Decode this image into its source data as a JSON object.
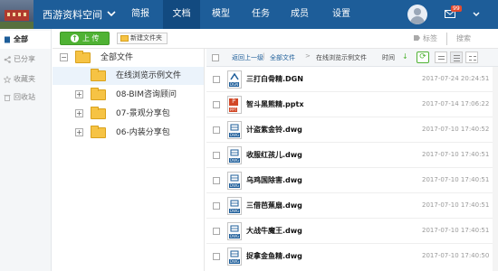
{
  "header": {
    "site_title": "西游资料空间",
    "nav": [
      "简报",
      "文档",
      "模型",
      "任务",
      "成员",
      "设置"
    ],
    "active_nav": "文档",
    "mail_badge": "99",
    "accent_color": "#1d5d99"
  },
  "sidebar": {
    "items": [
      {
        "label": "全部",
        "icon": "document-icon"
      },
      {
        "label": "已分享",
        "icon": "share-icon"
      },
      {
        "label": "收藏夹",
        "icon": "star-icon"
      },
      {
        "label": "回收站",
        "icon": "trash-icon"
      }
    ]
  },
  "toolbar": {
    "upload_label": "上 传",
    "new_folder_label": "新建文件夹",
    "tag_label": "标签",
    "search_label": "搜索"
  },
  "tree": {
    "root": "全部文件",
    "nodes": [
      {
        "label": "在线浏览示例文件",
        "expander": ""
      },
      {
        "label": "08-BIM咨询顾问",
        "expander": "+"
      },
      {
        "label": "07-景观分享包",
        "expander": "+"
      },
      {
        "label": "06-内装分享包",
        "expander": "+"
      }
    ]
  },
  "breadcrumb": {
    "back": "返回上一级",
    "all": "全部文件",
    "separator": ">",
    "current": "在线浏览示例文件",
    "sort_label": "时间"
  },
  "files": [
    {
      "name": "三打白骨精.DGN",
      "date": "2017-07-24 20:24:51",
      "type": "dgn"
    },
    {
      "name": "智斗黑熊精.pptx",
      "date": "2017-07-14 17:06:22",
      "type": "pptx"
    },
    {
      "name": "计盗紫金铃.dwg",
      "date": "2017-07-10 17:40:52",
      "type": "dwg"
    },
    {
      "name": "收服红孩儿.dwg",
      "date": "2017-07-10 17:40:51",
      "type": "dwg"
    },
    {
      "name": "乌鸡国除害.dwg",
      "date": "2017-07-10 17:40:51",
      "type": "dwg"
    },
    {
      "name": "三借芭蕉扇.dwg",
      "date": "2017-07-10 17:40:51",
      "type": "dwg"
    },
    {
      "name": "大战牛魔王.dwg",
      "date": "2017-07-10 17:40:51",
      "type": "dwg"
    },
    {
      "name": "捉拿金鱼精.dwg",
      "date": "2017-07-10 17:40:50",
      "type": "dwg"
    }
  ]
}
